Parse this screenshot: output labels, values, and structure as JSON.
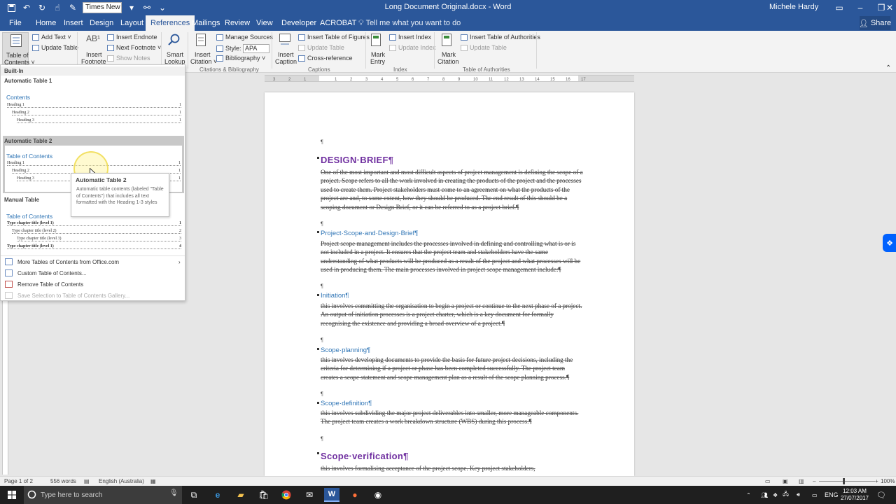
{
  "titlebar": {
    "font_box": "Times New F",
    "doc_title": "Long Document Original.docx - Word",
    "user": "Michele Hardy"
  },
  "menu": {
    "tabs": [
      "File",
      "Home",
      "Insert",
      "Design",
      "Layout",
      "References",
      "Mailings",
      "Review",
      "View",
      "Developer",
      "ACROBAT"
    ],
    "active": "References",
    "tell_me": "Tell me what you want to do",
    "share": "Share"
  },
  "ribbon": {
    "toc": {
      "label1": "Table of",
      "label2": "Contents ˅",
      "add_text": "Add Text ˅",
      "update_table": "Update Table"
    },
    "footnotes": {
      "insert_footnote1": "Insert",
      "insert_footnote2": "Footnote",
      "insert_endnote": "Insert Endnote",
      "next_footnote": "Next Footnote ˅",
      "show_notes": "Show Notes"
    },
    "research": {
      "smart1": "Smart",
      "smart2": "Lookup"
    },
    "citations": {
      "insert1": "Insert",
      "insert2": "Citation ˅",
      "manage_sources": "Manage Sources",
      "style_label": "Style:",
      "style_value": "APA",
      "bibliography": "Bibliography ˅",
      "group_label": "Citations & Bibliography"
    },
    "captions": {
      "insert1": "Insert",
      "insert2": "Caption",
      "insert_tof": "Insert Table of Figures",
      "update_table": "Update Table",
      "cross_reference": "Cross-reference",
      "group_label": "Captions"
    },
    "index": {
      "mark1": "Mark",
      "mark2": "Entry",
      "insert_index": "Insert Index",
      "update_index": "Update Index",
      "group_label": "Index"
    },
    "toa": {
      "mark1": "Mark",
      "mark2": "Citation",
      "insert_toa": "Insert Table of Authorities",
      "update_table": "Update Table",
      "group_label": "Table of Authorities"
    }
  },
  "dropdown": {
    "builtin": "Built-In",
    "auto1": {
      "name": "Automatic Table 1",
      "title": "Contents",
      "lines": [
        {
          "text": "Heading 1",
          "num": "1"
        },
        {
          "text": "Heading 2",
          "num": "1"
        },
        {
          "text": "Heading 3",
          "num": "1"
        }
      ]
    },
    "auto2": {
      "name": "Automatic Table 2",
      "title": "Table of Contents",
      "lines": [
        {
          "text": "Heading 1",
          "num": "1"
        },
        {
          "text": "Heading 2",
          "num": "1"
        },
        {
          "text": "Heading 3",
          "num": "1"
        }
      ]
    },
    "manual": {
      "name": "Manual Table",
      "title": "Table of Contents",
      "lines": [
        {
          "text": "Type chapter title (level 1)",
          "num": "1"
        },
        {
          "text": "Type chapter title (level 2)",
          "num": "2"
        },
        {
          "text": "Type chapter title (level 3)",
          "num": "3"
        },
        {
          "text": "Type chapter title (level 1)",
          "num": "4"
        }
      ]
    },
    "items": [
      "More Tables of Contents from Office.com",
      "Custom Table of Contents...",
      "Remove Table of Contents",
      "Save Selection to Table of Contents Gallery..."
    ]
  },
  "tooltip": {
    "title": "Automatic Table 2",
    "desc": "Automatic table contents (labeled \"Table of Contents\") that includes all text formatted with the Heading 1-3 styles"
  },
  "document": {
    "pilcrow": "¶",
    "h1_design": "DESIGN·BRIEF¶",
    "p_design": "One of the most important and most difficult aspects of project management is defining the scope of a project. Scope refers to all the work involved in creating the products of the project and the processes used to create them. Project stakeholders must come to an agreement on what the products of the project are and, to some extent, how they should be produced. The end result of this should be a scoping document or Design Brief, or it can be referred to as a project brief.¶",
    "h2_scope": "Project·Scope·and·Design·Brief¶",
    "p_scope": "Project scope management includes the processes involved in defining and controlling what is or is not included in a project. It ensures that the project team and stakeholders have the same understanding of what products will be produced as a result of the project and what processes will be used in producing them. The main processes involved in project scope management include:¶",
    "h2_initiation": "Initiation¶",
    "p_initiation": "this involves committing the organisation to begin a project or continue to the next phase of a project. An output of initiation processes is a project charter, which is a key document for formally recognising the existence and providing a broad overview of a project.¶",
    "h2_planning": "Scope·planning¶",
    "p_planning": "this involves developing documents to provide the basis for future project decisions, including the criteria for determining if a project or phase has been completed successfully. The project team creates a scope statement and scope management plan as a result of the scope planning process.¶",
    "h2_definition": "Scope·definition¶",
    "p_definition": "this involves subdividing the major project deliverables into smaller, more manageable components. The project team creates a work breakdown structure (WBS) during this process.¶",
    "h1_verification": "Scope·verification¶",
    "p_verification": "this involves formalising acceptance of the project scope. Key project stakeholders,"
  },
  "statusbar": {
    "page": "Page 1 of 2",
    "words": "556 words",
    "language": "English (Australia)",
    "zoom": "100%"
  },
  "taskbar": {
    "search": "Type here to search",
    "lang": "ENG",
    "time": "12:03 AM",
    "date": "27/07/2017"
  },
  "colors": {
    "word_blue": "#2b579a",
    "heading_purple": "#7030a0",
    "heading_blue": "#2e74b5"
  }
}
